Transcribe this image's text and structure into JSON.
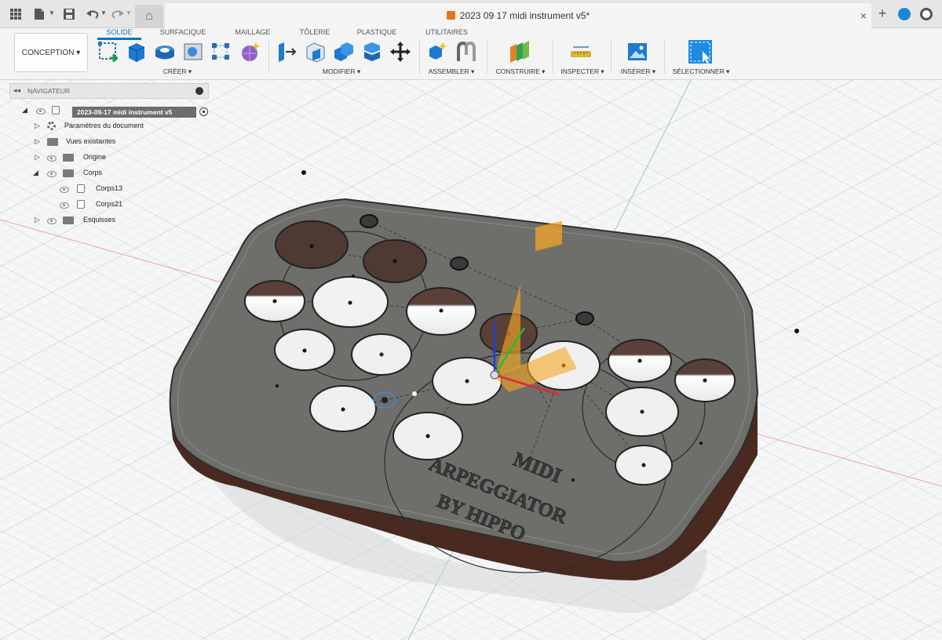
{
  "window": {
    "document_title": "2023 09 17 midi instrument v5*",
    "close_glyph": "×",
    "new_tab_glyph": "+",
    "home_glyph": "⌂"
  },
  "ribbon": {
    "workspace_label": "CONCEPTION ▾",
    "tabs": [
      "SOLIDE",
      "SURFACIQUE",
      "MAILLAGE",
      "TÔLERIE",
      "PLASTIQUE",
      "UTILITAIRES"
    ],
    "active_tab": "SOLIDE",
    "groups": [
      "CRÉER ▾",
      "MODIFIER ▾",
      "ASSEMBLER ▾",
      "CONSTRUIRE ▾",
      "INSPECTER ▾",
      "INSÉRER ▾",
      "SÉLECTIONNER ▾"
    ]
  },
  "navigator": {
    "title": "NAVIGATEUR",
    "root": "2023-09-17 midi instrument v5",
    "items": [
      {
        "label": "Paramètres du document"
      },
      {
        "label": "Vues existantes"
      },
      {
        "label": "Origine"
      },
      {
        "label": "Corps"
      },
      {
        "label": "Corps13"
      },
      {
        "label": "Corps21"
      },
      {
        "label": "Esquisses"
      }
    ]
  },
  "model": {
    "engraving_line1": "MIDI",
    "engraving_line2": "ARPEGGIATOR",
    "engraving_line3": "BY HIPPO"
  },
  "colors": {
    "accent": "#0a74c7",
    "plate": "#6e6e6b",
    "base": "#4a2a20",
    "gizmo": "#f5a623",
    "grid": "#d9dadc"
  },
  "icons": [
    "grid-menu-icon",
    "file-icon",
    "save-icon",
    "undo-icon",
    "redo-icon",
    "home-icon",
    "cube-icon",
    "close-icon",
    "plus-icon",
    "sync-icon",
    "clock-icon"
  ]
}
